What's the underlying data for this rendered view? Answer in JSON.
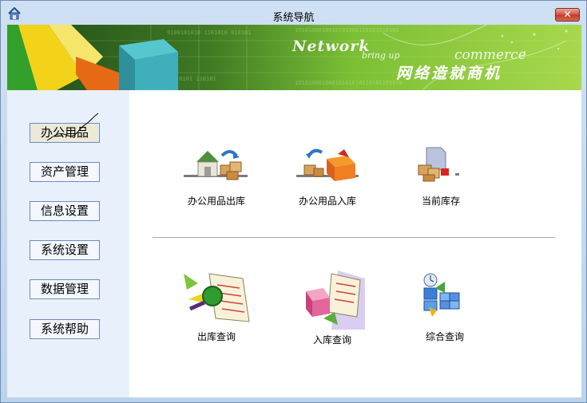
{
  "window": {
    "title": "系统导航",
    "close_glyph": "✕"
  },
  "banner": {
    "word_network": "Network",
    "word_bring": "bring up",
    "word_commerce": "commerce",
    "word_cn": "网络造就商机"
  },
  "sidebar": {
    "items": [
      {
        "label": "办公用品",
        "active": true
      },
      {
        "label": "资产管理"
      },
      {
        "label": "信息设置"
      },
      {
        "label": "系统设置"
      },
      {
        "label": "数据管理"
      },
      {
        "label": "系统帮助"
      }
    ]
  },
  "main": {
    "row1": [
      {
        "label": "办公用品出库",
        "icon": "warehouse-out-icon"
      },
      {
        "label": "办公用品入库",
        "icon": "warehouse-in-icon"
      },
      {
        "label": "当前库存",
        "icon": "inventory-icon"
      }
    ],
    "row2": [
      {
        "label": "出库查询",
        "icon": "outbound-query-icon"
      },
      {
        "label": "入库查询",
        "icon": "inbound-query-icon"
      },
      {
        "label": "综合查询",
        "icon": "combined-query-icon"
      }
    ]
  },
  "colors": {
    "banner_green": "#7fc33a",
    "banner_dark": "#2f5f1e",
    "window_frame": "#bcd3ec",
    "close_red": "#c8432b"
  }
}
